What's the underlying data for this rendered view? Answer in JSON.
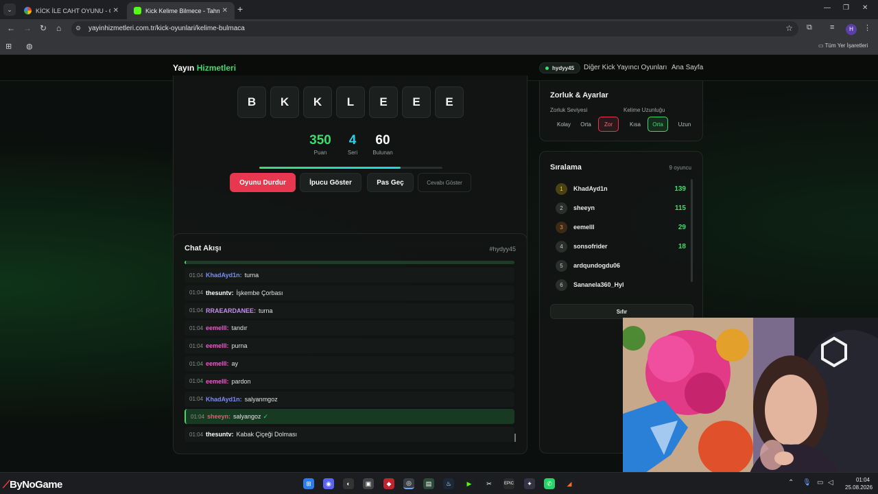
{
  "browser": {
    "tabs": [
      {
        "title": "KİCK İLE CAHT OYUNU - Google",
        "active": false
      },
      {
        "title": "Kick Kelime Bilmece - Tahmin O",
        "active": true
      }
    ],
    "url": "yayinhizmetleri.com.tr/kick-oyunlari/kelime-bulmaca",
    "bookmarks_all": "Tüm Yer İşaretleri",
    "profile_initial": "H"
  },
  "site": {
    "brand_prefix": "Yayın",
    "brand_highlight": "Hizmetleri",
    "username": "hydyy45",
    "nav": [
      "Diğer Kick Yayıncı Oyunları",
      "Ana Sayfa"
    ]
  },
  "game": {
    "letters": [
      "B",
      "K",
      "K",
      "L",
      "E",
      "E",
      "E"
    ],
    "stats": [
      {
        "value": "350",
        "label": "Puan",
        "color": "#3ddc6d"
      },
      {
        "value": "4",
        "label": "Seri",
        "color": "#22d3ee"
      },
      {
        "value": "60",
        "label": "Bulunan",
        "color": "#ffffff"
      }
    ],
    "progress_fraction": 0.77,
    "buttons": {
      "stop": "Oyunu Durdur",
      "hint": "İpucu Göster",
      "skip": "Pas Geç",
      "reveal": "Cevabı Göster"
    }
  },
  "settings": {
    "title": "Zorluk & Ayarlar",
    "difficulty_label": "Zorluk Seviyesi",
    "difficulty_options": [
      "Kolay",
      "Orta",
      "Zor"
    ],
    "difficulty_selected": "Zor",
    "length_label": "Kelime Uzunluğu",
    "length_options": [
      "Kısa",
      "Orta",
      "Uzun"
    ],
    "length_selected": "Orta"
  },
  "ranking": {
    "title": "Sıralama",
    "count": "9 oyuncu",
    "rows": [
      {
        "rank": "1",
        "name": "KhadAyd1n",
        "score": "139"
      },
      {
        "rank": "2",
        "name": "sheeyn",
        "score": "115"
      },
      {
        "rank": "3",
        "name": "eemelll",
        "score": "29"
      },
      {
        "rank": "4",
        "name": "sonsofrider",
        "score": "18"
      },
      {
        "rank": "5",
        "name": "ardqundogdu06",
        "score": ""
      },
      {
        "rank": "6",
        "name": "Sananela360_Hyl",
        "score": ""
      }
    ],
    "reset_label": "Sıfır"
  },
  "chat": {
    "title": "Chat Akışı",
    "channel": "#hydyy45",
    "messages": [
      {
        "time": "01:04",
        "user": "KhadAyd1n:",
        "text": "turna",
        "color": "#7c8cf8",
        "hit": false
      },
      {
        "time": "01:04",
        "user": "thesuntv:",
        "text": "İşkembe Çorbası",
        "color": "#ffffff",
        "hit": false
      },
      {
        "time": "01:04",
        "user": "RRAEARDANEE:",
        "text": "turna",
        "color": "#c98cf5",
        "hit": false
      },
      {
        "time": "01:04",
        "user": "eemelll:",
        "text": "tandır",
        "color": "#e45fd0",
        "hit": false
      },
      {
        "time": "01:04",
        "user": "eemelll:",
        "text": "purna",
        "color": "#e45fd0",
        "hit": false
      },
      {
        "time": "01:04",
        "user": "eemelll:",
        "text": "ay",
        "color": "#e45fd0",
        "hit": false
      },
      {
        "time": "01:04",
        "user": "eemelll:",
        "text": "pardon",
        "color": "#e45fd0",
        "hit": false
      },
      {
        "time": "01:04",
        "user": "KhadAyd1n:",
        "text": "salyanmgoz",
        "color": "#7c8cf8",
        "hit": false
      },
      {
        "time": "01:04",
        "user": "sheeyn:",
        "text": "salyangoz",
        "color": "#f2576b",
        "hit": true
      },
      {
        "time": "01:04",
        "user": "thesuntv:",
        "text": "Kabak Çiçeği Dolması",
        "color": "#ffffff",
        "hit": false
      }
    ],
    "correct_mark": "✓"
  },
  "taskbar": {
    "brand": "ByNoGame",
    "time": "01:04",
    "date": "25.08.2026"
  }
}
